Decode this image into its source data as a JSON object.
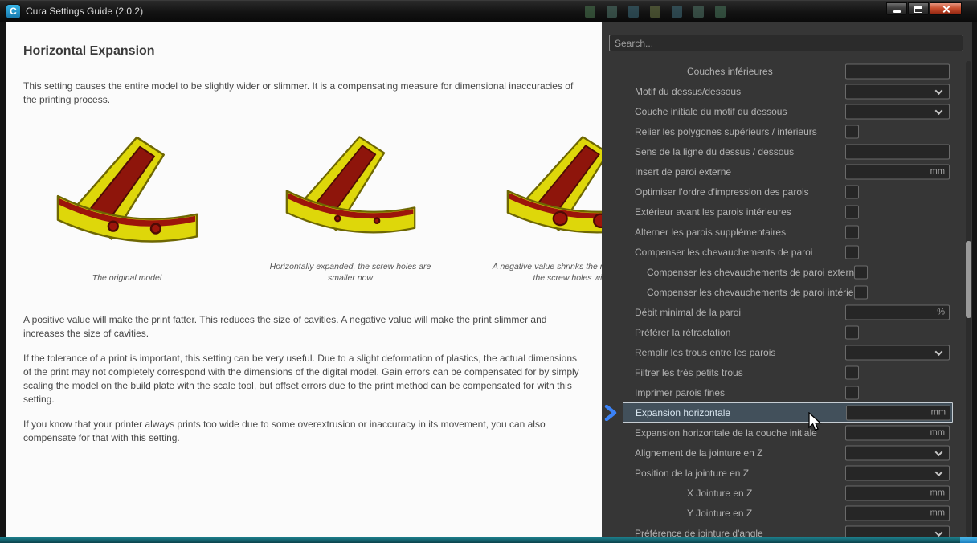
{
  "window": {
    "title": "Cura Settings Guide (2.0.2)",
    "app_icon_letter": "C"
  },
  "article": {
    "title": "Horizontal Expansion",
    "intro": "This setting causes the entire model to be slightly wider or slimmer. It is a compensating measure for dimensional inaccuracies of the printing process.",
    "figures": [
      {
        "variant": "original",
        "caption": "The original model"
      },
      {
        "variant": "expanded",
        "caption": "Horizontally expanded, the screw holes are smaller now"
      },
      {
        "variant": "negative",
        "caption": "A negative value shrinks the model, making the screw holes wider"
      }
    ],
    "paragraphs": [
      "A positive value will make the print fatter. This reduces the size of cavities. A negative value will make the print slimmer and increases the size of cavities.",
      "If the tolerance of a print is important, this setting can be very useful. Due to a slight deformation of plastics, the actual dimensions of the print may not completely correspond with the dimensions of the digital model. Gain errors can be compensated for by simply scaling the model on the build plate with the scale tool, but offset errors due to the print method can be compensated for with this setting.",
      "If you know that your printer always prints too wide due to some overextrusion or inaccuracy in its movement, you can also compensate for that with this setting."
    ]
  },
  "settings_panel": {
    "search_placeholder": "Search...",
    "rows": [
      {
        "label": "Couches inférieures",
        "indent": 2,
        "control": "text",
        "unit": ""
      },
      {
        "label": "Motif du dessus/dessous",
        "indent": 0,
        "control": "dropdown"
      },
      {
        "label": "Couche initiale du motif du dessous",
        "indent": 0,
        "control": "dropdown"
      },
      {
        "label": "Relier les polygones supérieurs / inférieurs",
        "indent": 0,
        "control": "checkbox"
      },
      {
        "label": "Sens de la ligne du dessus / dessous",
        "indent": 0,
        "control": "text",
        "unit": ""
      },
      {
        "label": "Insert de paroi externe",
        "indent": 0,
        "control": "text",
        "unit": "mm"
      },
      {
        "label": "Optimiser l'ordre d'impression des parois",
        "indent": 0,
        "control": "checkbox"
      },
      {
        "label": "Extérieur avant les parois intérieures",
        "indent": 0,
        "control": "checkbox"
      },
      {
        "label": "Alterner les parois supplémentaires",
        "indent": 0,
        "control": "checkbox"
      },
      {
        "label": "Compenser les chevauchements de paroi",
        "indent": 0,
        "control": "checkbox"
      },
      {
        "label": "Compenser les chevauchements de paroi externe",
        "indent": 1,
        "control": "checkbox"
      },
      {
        "label": "Compenser les chevauchements de paroi intérieure",
        "indent": 1,
        "control": "checkbox"
      },
      {
        "label": "Débit minimal de la paroi",
        "indent": 0,
        "control": "text",
        "unit": "%"
      },
      {
        "label": "Préférer la rétractation",
        "indent": 0,
        "control": "checkbox"
      },
      {
        "label": "Remplir les trous entre les parois",
        "indent": 0,
        "control": "dropdown"
      },
      {
        "label": "Filtrer les très petits trous",
        "indent": 0,
        "control": "checkbox"
      },
      {
        "label": "Imprimer parois fines",
        "indent": 0,
        "control": "checkbox"
      },
      {
        "label": "Expansion horizontale",
        "indent": 0,
        "control": "text",
        "unit": "mm",
        "selected": true
      },
      {
        "label": "Expansion horizontale de la couche initiale",
        "indent": 0,
        "control": "text",
        "unit": "mm"
      },
      {
        "label": "Alignement de la jointure en Z",
        "indent": 0,
        "control": "dropdown"
      },
      {
        "label": "Position de la jointure en Z",
        "indent": 0,
        "control": "dropdown"
      },
      {
        "label": "X Jointure en Z",
        "indent": 2,
        "control": "text",
        "unit": "mm"
      },
      {
        "label": "Y Jointure en Z",
        "indent": 2,
        "control": "text",
        "unit": "mm"
      },
      {
        "label": "Préférence de jointure d'angle",
        "indent": 0,
        "control": "dropdown"
      }
    ]
  }
}
